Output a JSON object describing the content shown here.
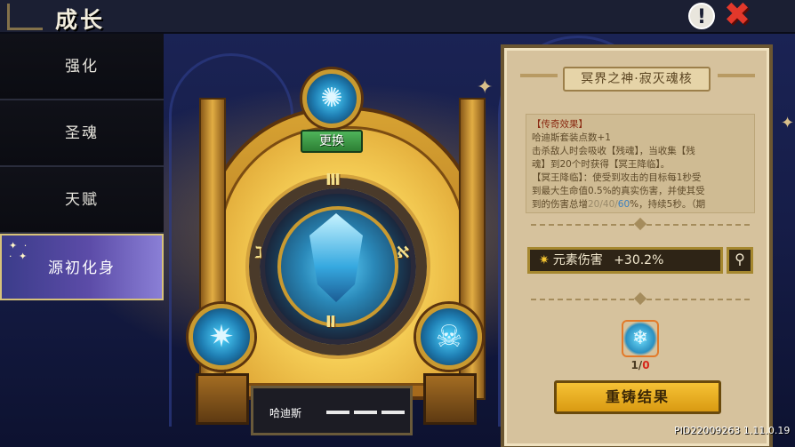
{
  "header": {
    "title": "成长",
    "info_icon": "exclamation-icon",
    "close_icon": "close-x-icon"
  },
  "menu": {
    "items": [
      {
        "label": "强化"
      },
      {
        "label": "圣魂"
      },
      {
        "label": "天赋"
      },
      {
        "label": "源初化身"
      }
    ],
    "active_index": 3
  },
  "mirror": {
    "change_button": "更换",
    "character_name": "哈迪斯",
    "runes": [
      "Ⅲ",
      "ℵ",
      "Ⅱ",
      "ℷ"
    ]
  },
  "panel": {
    "title": "冥界之神·寂灭魂核",
    "desc": {
      "line1": "【传奇效果】",
      "line2": "哈迪斯套装点数+1",
      "line3": "击杀敌人时会吸收【残魂】，当收集【残",
      "line4": "魂】到20个时获得【冥王降临】。",
      "line5": "【冥王降临】：使受到攻击的目标每1秒受",
      "line6": "到最大生命值0.5%的真实伤害，并使其受",
      "line7_a": "到的伤害总增",
      "line7_b": "20/40/",
      "line7_c": "60",
      "line7_d": "%，持续5秒。（期"
    },
    "stat_label": "元素伤害",
    "stat_value": "+30.2%",
    "item_count_have": "1/",
    "item_count_need": "0",
    "recast_button": "重铸结果"
  },
  "version": "PID22009263 1.11.0.19",
  "colors": {
    "accent_gold": "#d3a23d",
    "active_menu": "#5c4ca8",
    "recast": "#f6c235",
    "change_btn": "#4fb45a",
    "close_red": "#e2382b"
  }
}
